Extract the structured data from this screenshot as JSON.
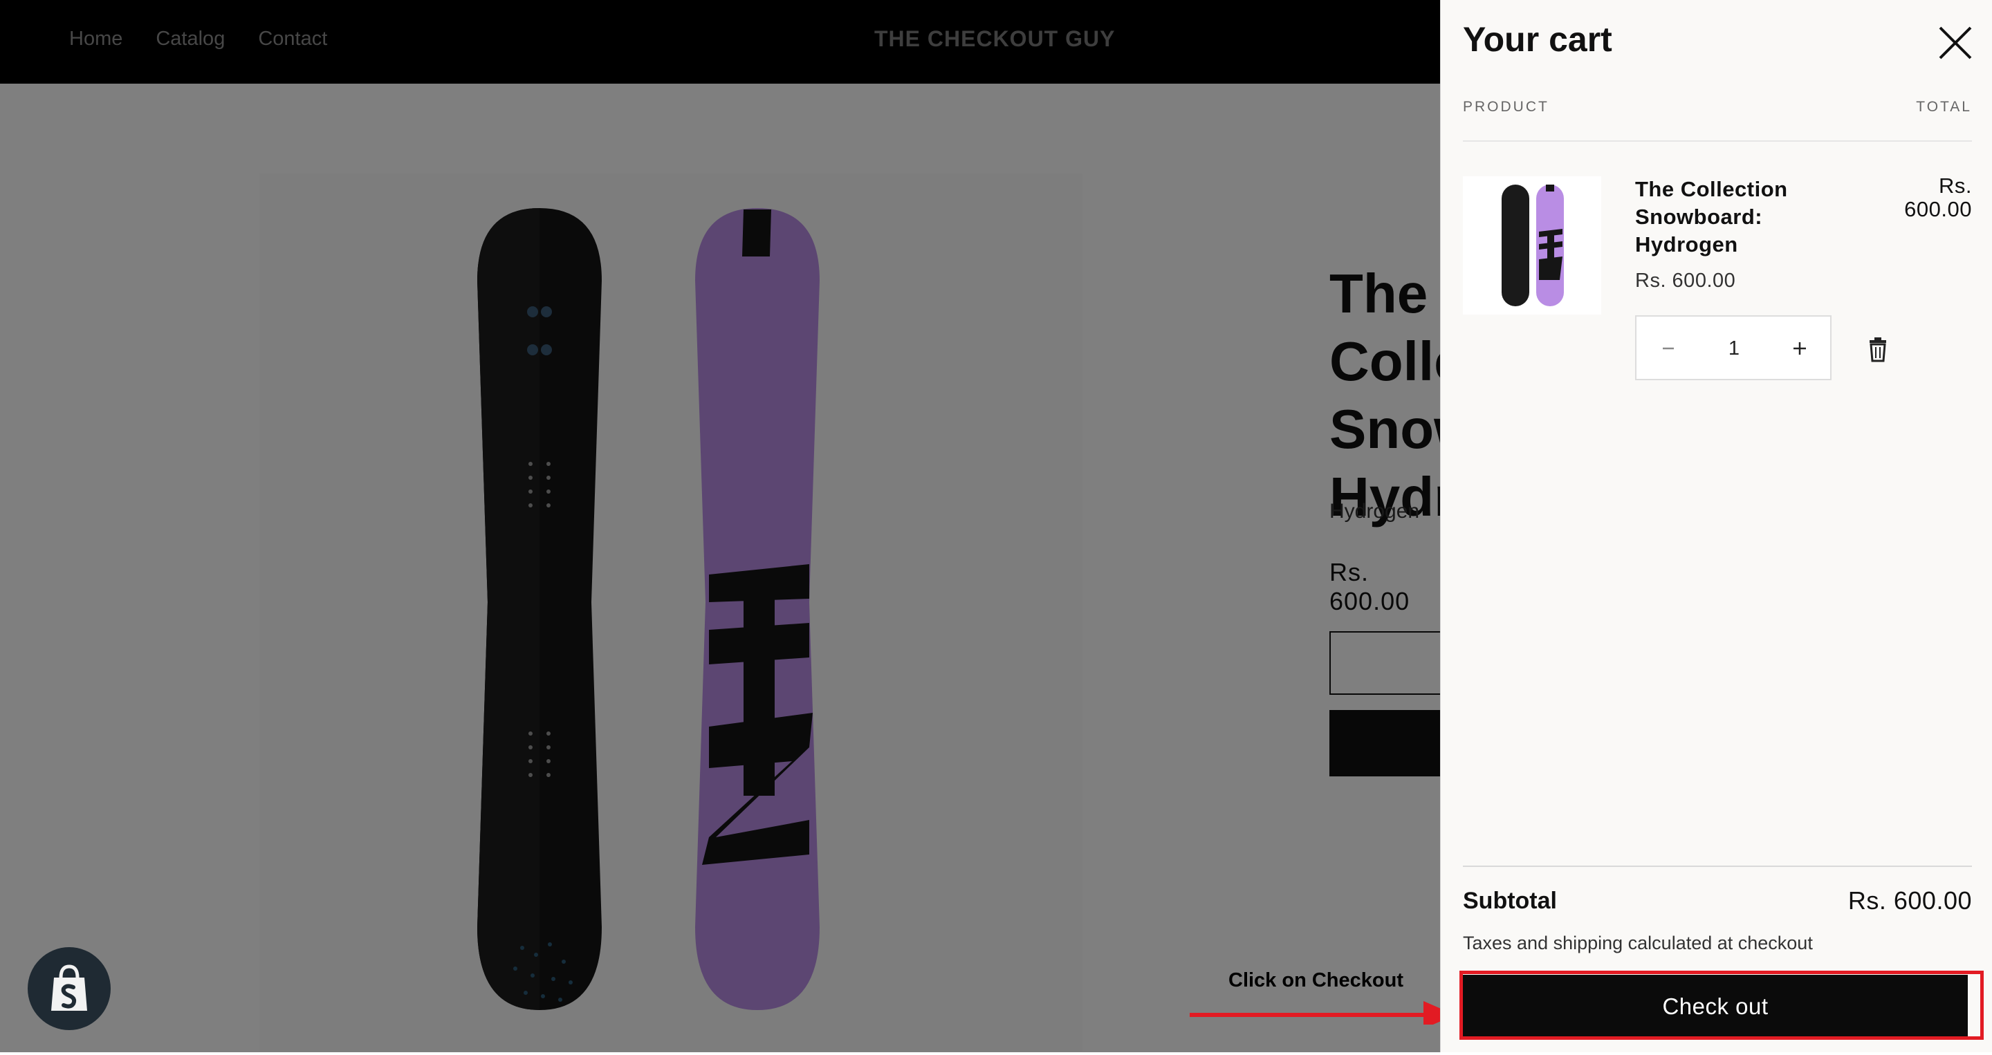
{
  "header": {
    "nav": [
      "Home",
      "Catalog",
      "Contact"
    ],
    "brand": "THE CHECKOUT GUY"
  },
  "product": {
    "title": "The Collection\nSnowboard:\nHydrogen",
    "subtitle": "Hydrogen",
    "price": "Rs. 600.00"
  },
  "annotation": {
    "text": "Click on Checkout",
    "color": "#e21b23"
  },
  "cart": {
    "title": "Your cart",
    "close_icon": "close-icon",
    "col_product": "PRODUCT",
    "col_total": "TOTAL",
    "items": [
      {
        "name": "The Collection Snowboard: Hydrogen",
        "price": "Rs. 600.00",
        "total": "Rs. 600.00",
        "quantity": "1"
      }
    ],
    "subtotal_label": "Subtotal",
    "subtotal_value": "Rs. 600.00",
    "tax_note": "Taxes and shipping calculated at checkout",
    "checkout_label": "Check out"
  },
  "colors": {
    "header_bg": "#000000",
    "overlay": "rgba(0,0,0,0.5)",
    "drawer_bg": "#faf9f7",
    "board_purple": "#b98de4",
    "highlight": "#e21b23"
  }
}
